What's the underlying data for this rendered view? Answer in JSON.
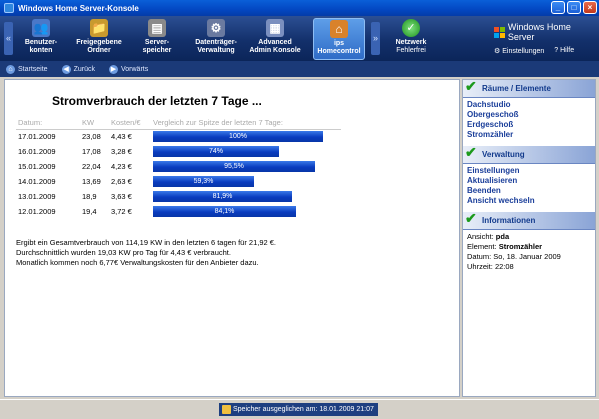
{
  "window": {
    "title": "Windows Home Server-Konsole"
  },
  "toolbar": {
    "items": [
      {
        "label": "Benutzer-\nkonten",
        "icon": "users-icon"
      },
      {
        "label": "Freigegebene\nOrdner",
        "icon": "shared-folders-icon"
      },
      {
        "label": "Server-\nspeicher",
        "icon": "server-storage-icon"
      },
      {
        "label": "Datenträger-\nVerwaltung",
        "icon": "gear-icon"
      },
      {
        "label": "Advanced\nAdmin Konsole",
        "icon": "admin-console-icon"
      },
      {
        "label": "ips\nHomecontrol",
        "icon": "home-icon"
      }
    ],
    "network": {
      "label": "Netzwerk",
      "status": "Fehlerfrei"
    },
    "brand": "Windows Home Server",
    "settings_label": "Einstellungen",
    "help_label": "Hilfe"
  },
  "navbar": {
    "start": "Startseite",
    "back": "Zurück",
    "forward": "Vorwärts"
  },
  "content": {
    "title": "Stromverbrauch der letzten 7 Tage ...",
    "headers": [
      "Datum:",
      "KW",
      "Kosten/€",
      "Vergleich zur Spitze der letzten 7 Tage:"
    ],
    "rows": [
      {
        "date": "17.01.2009",
        "kw": "23,08",
        "cost": "4,43 €",
        "pct": 100,
        "pct_label": "100%"
      },
      {
        "date": "16.01.2009",
        "kw": "17,08",
        "cost": "3,28 €",
        "pct": 74,
        "pct_label": "74%"
      },
      {
        "date": "15.01.2009",
        "kw": "22,04",
        "cost": "4,23 €",
        "pct": 95.5,
        "pct_label": "95,5%"
      },
      {
        "date": "14.01.2009",
        "kw": "13,69",
        "cost": "2,63 €",
        "pct": 59.3,
        "pct_label": "59,3%"
      },
      {
        "date": "13.01.2009",
        "kw": "18,9",
        "cost": "3,63 €",
        "pct": 81.9,
        "pct_label": "81,9%"
      },
      {
        "date": "12.01.2009",
        "kw": "19,4",
        "cost": "3,72 €",
        "pct": 84.1,
        "pct_label": "84,1%"
      }
    ],
    "summary": [
      "Ergibt ein Gesamtverbrauch von 114,19 KW in den letzten 6 tagen für 21,92 €.",
      "Durchschnittlich wurden 19,03 KW pro Tag für 4,43 € verbraucht.",
      "Monatlich kommen noch 6,77€ Verwaltungskosten für den Anbieter dazu."
    ]
  },
  "side": {
    "rooms": {
      "title": "Räume / Elemente",
      "links": [
        "Dachstudio",
        "Obergeschoß",
        "Erdgeschoß",
        "Stromzähler"
      ]
    },
    "admin": {
      "title": "Verwaltung",
      "links": [
        "Einstellungen",
        "Aktualisieren",
        "Beenden",
        "Ansicht wechseln"
      ]
    },
    "info": {
      "title": "Informationen",
      "view_label": "Ansicht:",
      "view_value": "pda",
      "element_label": "Element:",
      "element_value": "Stromzähler",
      "date_label": "Datum:",
      "date_value": "So, 18. Januar 2009",
      "time_label": "Uhrzeit:",
      "time_value": "22:08"
    }
  },
  "status": {
    "text": "Speicher ausgeglichen am: 18.01.2009 21:07"
  }
}
